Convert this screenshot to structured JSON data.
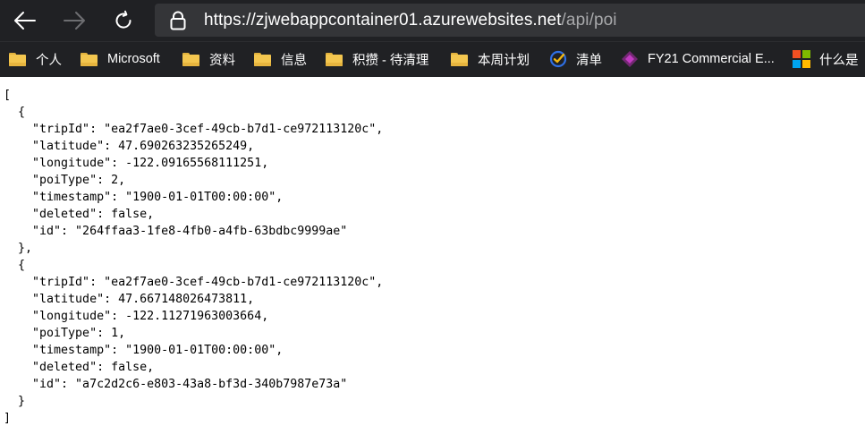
{
  "toolbar": {
    "back_label": "Back",
    "forward_label": "Forward",
    "refresh_label": "Refresh"
  },
  "address_bar": {
    "host": "https://zjwebappcontainer01.azurewebsites.net",
    "path": "/api/poi",
    "lock_icon": "lock-icon"
  },
  "favorites": [
    {
      "label": "个人",
      "icon": "folder-icon"
    },
    {
      "label": "Microsoft",
      "icon": "folder-icon"
    },
    {
      "label": "资料",
      "icon": "folder-icon"
    },
    {
      "label": "信息",
      "icon": "folder-icon"
    },
    {
      "label": "积攒 - 待清理",
      "icon": "folder-icon"
    },
    {
      "label": "本周计划",
      "icon": "folder-icon"
    },
    {
      "label": "清单",
      "icon": "todo-check-icon"
    },
    {
      "label": "FY21 Commercial E...",
      "icon": "power-apps-icon"
    },
    {
      "label": "什么是",
      "icon": "microsoft-logo-icon"
    }
  ],
  "json_lines": [
    "[",
    "  {",
    "    \"tripId\": \"ea2f7ae0-3cef-49cb-b7d1-ce972113120c\",",
    "    \"latitude\": 47.690263235265249,",
    "    \"longitude\": -122.09165568111251,",
    "    \"poiType\": 2,",
    "    \"timestamp\": \"1900-01-01T00:00:00\",",
    "    \"deleted\": false,",
    "    \"id\": \"264ffaa3-1fe8-4fb0-a4fb-63bdbc9999ae\"",
    "  },",
    "  {",
    "    \"tripId\": \"ea2f7ae0-3cef-49cb-b7d1-ce972113120c\",",
    "    \"latitude\": 47.667148026473811,",
    "    \"longitude\": -122.11271963003664,",
    "    \"poiType\": 1,",
    "    \"timestamp\": \"1900-01-01T00:00:00\",",
    "    \"deleted\": false,",
    "    \"id\": \"a7c2d2c6-e803-43a8-bf3d-340b7987e73a\"",
    "  }",
    "]"
  ],
  "colors": {
    "chrome_bg": "#202124",
    "address_bg": "#343538",
    "url_path": "#a8a9ab",
    "folder": "#f3c64f"
  }
}
